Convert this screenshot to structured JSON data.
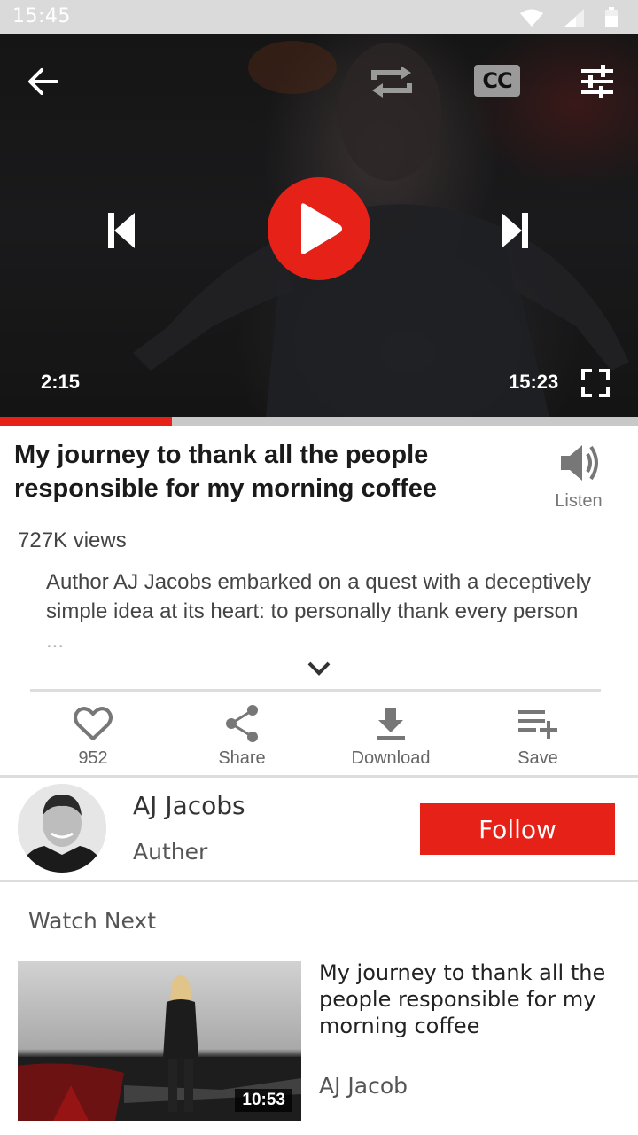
{
  "status_bar": {
    "time": "15:45"
  },
  "player": {
    "elapsed": "2:15",
    "duration": "15:23",
    "progress": 0.27,
    "cc_label": "CC",
    "colors": {
      "accent": "#e62117"
    }
  },
  "video": {
    "title": "My journey to thank all the people responsible for my morning coffee",
    "listen_label": "Listen",
    "views": "727K views",
    "description": "Author AJ Jacobs embarked on a quest with a deceptively simple idea at its heart: to personally thank every person ..."
  },
  "actions": {
    "like_count": "952",
    "share_label": "Share",
    "download_label": "Download",
    "save_label": "Save"
  },
  "author": {
    "name": "AJ Jacobs",
    "role": "Auther",
    "follow_label": "Follow"
  },
  "watch_next": {
    "heading": "Watch Next",
    "items": [
      {
        "title": "My journey to thank all the people responsible for my morning coffee",
        "author": "AJ Jacob",
        "duration": "10:53"
      }
    ]
  }
}
